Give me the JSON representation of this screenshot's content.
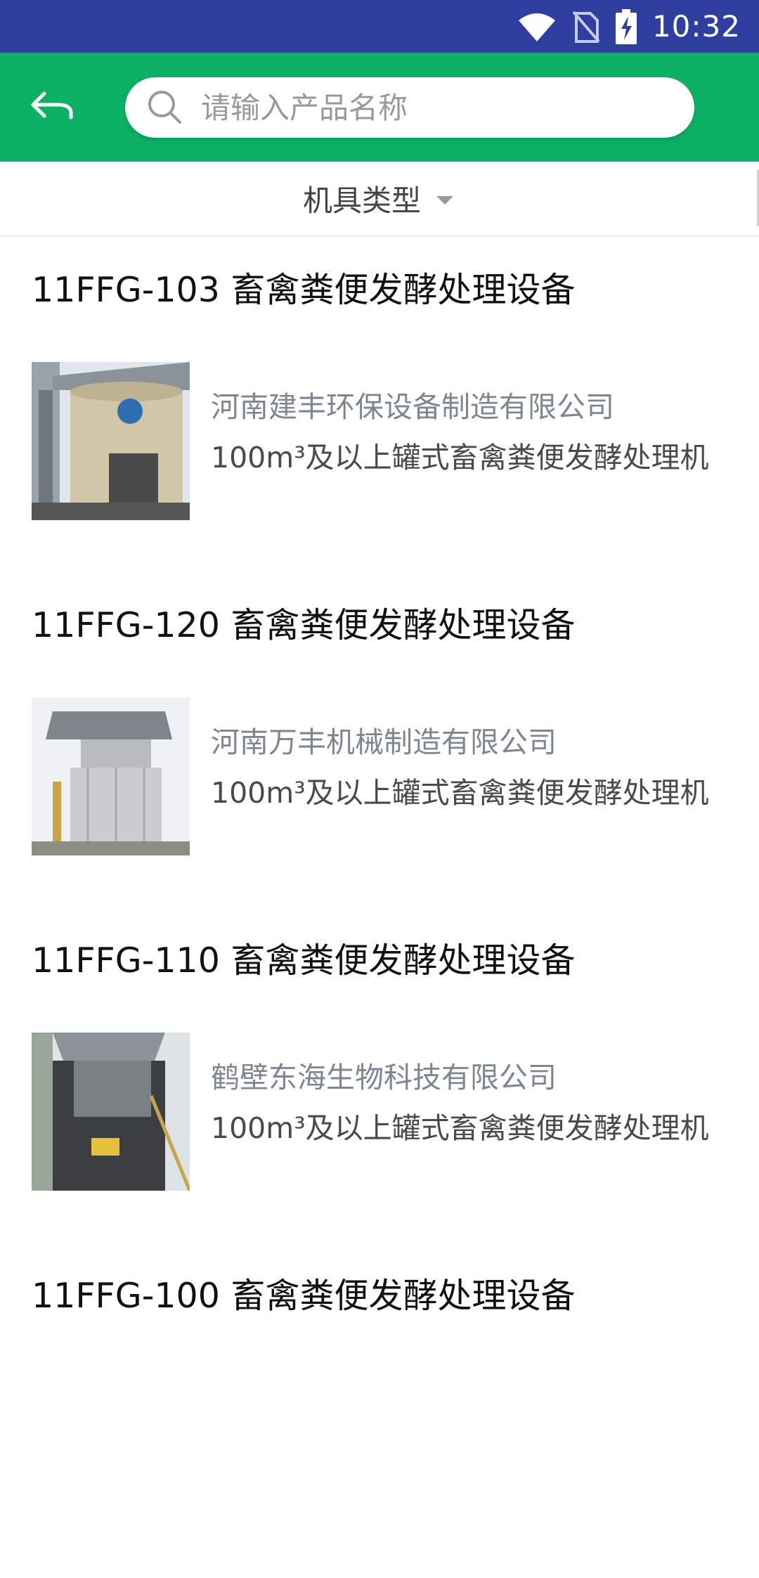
{
  "status_bar": {
    "time": "10:32",
    "icons": [
      "wifi-icon",
      "no-sim-icon",
      "battery-charging-icon"
    ]
  },
  "header": {
    "back_icon": "back-arrow-icon",
    "search": {
      "icon": "search-icon",
      "placeholder": "请输入产品名称",
      "value": ""
    }
  },
  "filter": {
    "label": "机具类型",
    "icon": "dropdown-caret-icon"
  },
  "colors": {
    "status_bar": "#303F9F",
    "app_bar": "#0DB163"
  },
  "products": [
    {
      "title": "11FFG-103 畜禽粪便发酵处理设备",
      "company": "河南建丰环保设备制造有限公司",
      "description": "100m³及以上罐式畜禽粪便发酵处理机",
      "image": "fermentation-tank-photo"
    },
    {
      "title": "11FFG-120 畜禽粪便发酵处理设备",
      "company": "河南万丰机械制造有限公司",
      "description": "100m³及以上罐式畜禽粪便发酵处理机",
      "image": "fermentation-tank-photo"
    },
    {
      "title": "11FFG-110 畜禽粪便发酵处理设备",
      "company": "鹤壁东海生物科技有限公司",
      "description": "100m³及以上罐式畜禽粪便发酵处理机",
      "image": "fermentation-tank-photo"
    },
    {
      "title": "11FFG-100 畜禽粪便发酵处理设备"
    }
  ]
}
